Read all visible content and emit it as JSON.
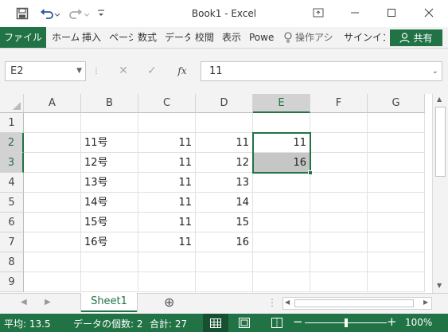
{
  "titlebar": {
    "title": "Book1 - Excel",
    "icons": [
      "save-icon",
      "undo-icon",
      "redo-icon",
      "customize-icon",
      "ribbon-display-icon",
      "minimize-icon",
      "maximize-icon",
      "close-icon"
    ]
  },
  "ribbon": {
    "tabs": [
      "ファイル",
      "ホーム",
      "挿入",
      "ページ",
      "数式",
      "データ",
      "校閲",
      "表示",
      "Powe"
    ],
    "tell_me": "操作アシ",
    "signin": "サインイン",
    "share": "共有"
  },
  "formula_bar": {
    "name_box": "E2",
    "cancel": "✕",
    "enter": "✓",
    "fx": "fx",
    "value": "11"
  },
  "sheet": {
    "columns": [
      "A",
      "B",
      "C",
      "D",
      "E",
      "F",
      "G"
    ],
    "rows": [
      "1",
      "2",
      "3",
      "4",
      "5",
      "6",
      "7",
      "8",
      "9"
    ],
    "cells": [
      [
        "",
        "",
        "",
        "",
        "",
        "",
        ""
      ],
      [
        "",
        "11号",
        "11",
        "11",
        "11",
        "",
        ""
      ],
      [
        "",
        "12号",
        "11",
        "12",
        "16",
        "",
        ""
      ],
      [
        "",
        "13号",
        "11",
        "13",
        "",
        "",
        ""
      ],
      [
        "",
        "14号",
        "11",
        "14",
        "",
        "",
        ""
      ],
      [
        "",
        "15号",
        "11",
        "15",
        "",
        "",
        ""
      ],
      [
        "",
        "16号",
        "11",
        "16",
        "",
        "",
        ""
      ],
      [
        "",
        "",
        "",
        "",
        "",
        "",
        ""
      ],
      [
        "",
        "",
        "",
        "",
        "",
        "",
        ""
      ]
    ],
    "numeric_columns": [
      2,
      3,
      4
    ],
    "selected_column": 4,
    "selected_rows": [
      1,
      2
    ]
  },
  "sheet_tabs": {
    "active": "Sheet1",
    "add": "⊕"
  },
  "status": {
    "average": "平均: 13.5",
    "count": "データの個数: 2",
    "sum": "合計: 27",
    "zoom": "100%",
    "zoom_level": 1.0
  },
  "colors": {
    "accent": "#217346",
    "selection_fill": "#c6c6c6"
  }
}
